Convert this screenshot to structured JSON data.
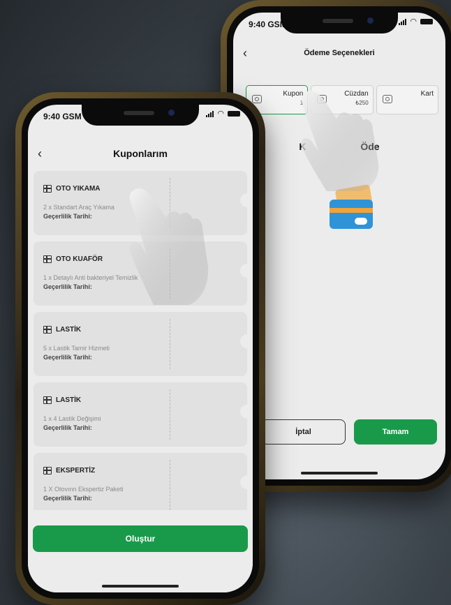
{
  "back_screen": {
    "status": {
      "time": "9:40 GSM"
    },
    "header": {
      "back_icon": "chevron-left-icon",
      "title": "Ödeme Seçenekleri"
    },
    "payment_tabs": [
      {
        "label": "Kupon",
        "value": "1",
        "icon": "coupon-icon",
        "active": true
      },
      {
        "label": "Cüzdan",
        "value": "₺250",
        "icon": "wallet-icon",
        "active": false
      },
      {
        "label": "Kart",
        "value": "",
        "icon": "card-icon",
        "active": false
      }
    ],
    "heading_left": "K",
    "heading_right": "Öde",
    "illustration": "credit-card-illustration",
    "buttons": {
      "cancel": "İptal",
      "ok": "Tamam"
    }
  },
  "front_screen": {
    "status": {
      "time": "9:40 GSM"
    },
    "header": {
      "back_icon": "chevron-left-icon",
      "title": "Kuponlarım"
    },
    "coupons": [
      {
        "title": "OTO YIKAMA",
        "desc": "2 x Standart Araç Yıkama",
        "validity": "Geçerlilik Tarihi:"
      },
      {
        "title": "OTO KUAFÖR",
        "desc": "1 x Detaylı Anti bakteriyel Temizlik",
        "validity": "Geçerlilik Tarihi:"
      },
      {
        "title": "LASTİK",
        "desc": "5 x Lastik Tamir Hizmeti",
        "validity": "Geçerlilik Tarihi:"
      },
      {
        "title": "LASTİK",
        "desc": "1 x 4 Lastik Değişimi",
        "validity": "Geçerlilik Tarihi:"
      },
      {
        "title": "EKSPERTİZ",
        "desc": "1 X Otovınn Ekspertiz Paketi",
        "validity": "Geçerlilik Tarihi:"
      }
    ],
    "create_button": "Oluştur"
  },
  "colors": {
    "accent": "#199a4a",
    "background": "#2f363c",
    "screen": "#ececec"
  }
}
